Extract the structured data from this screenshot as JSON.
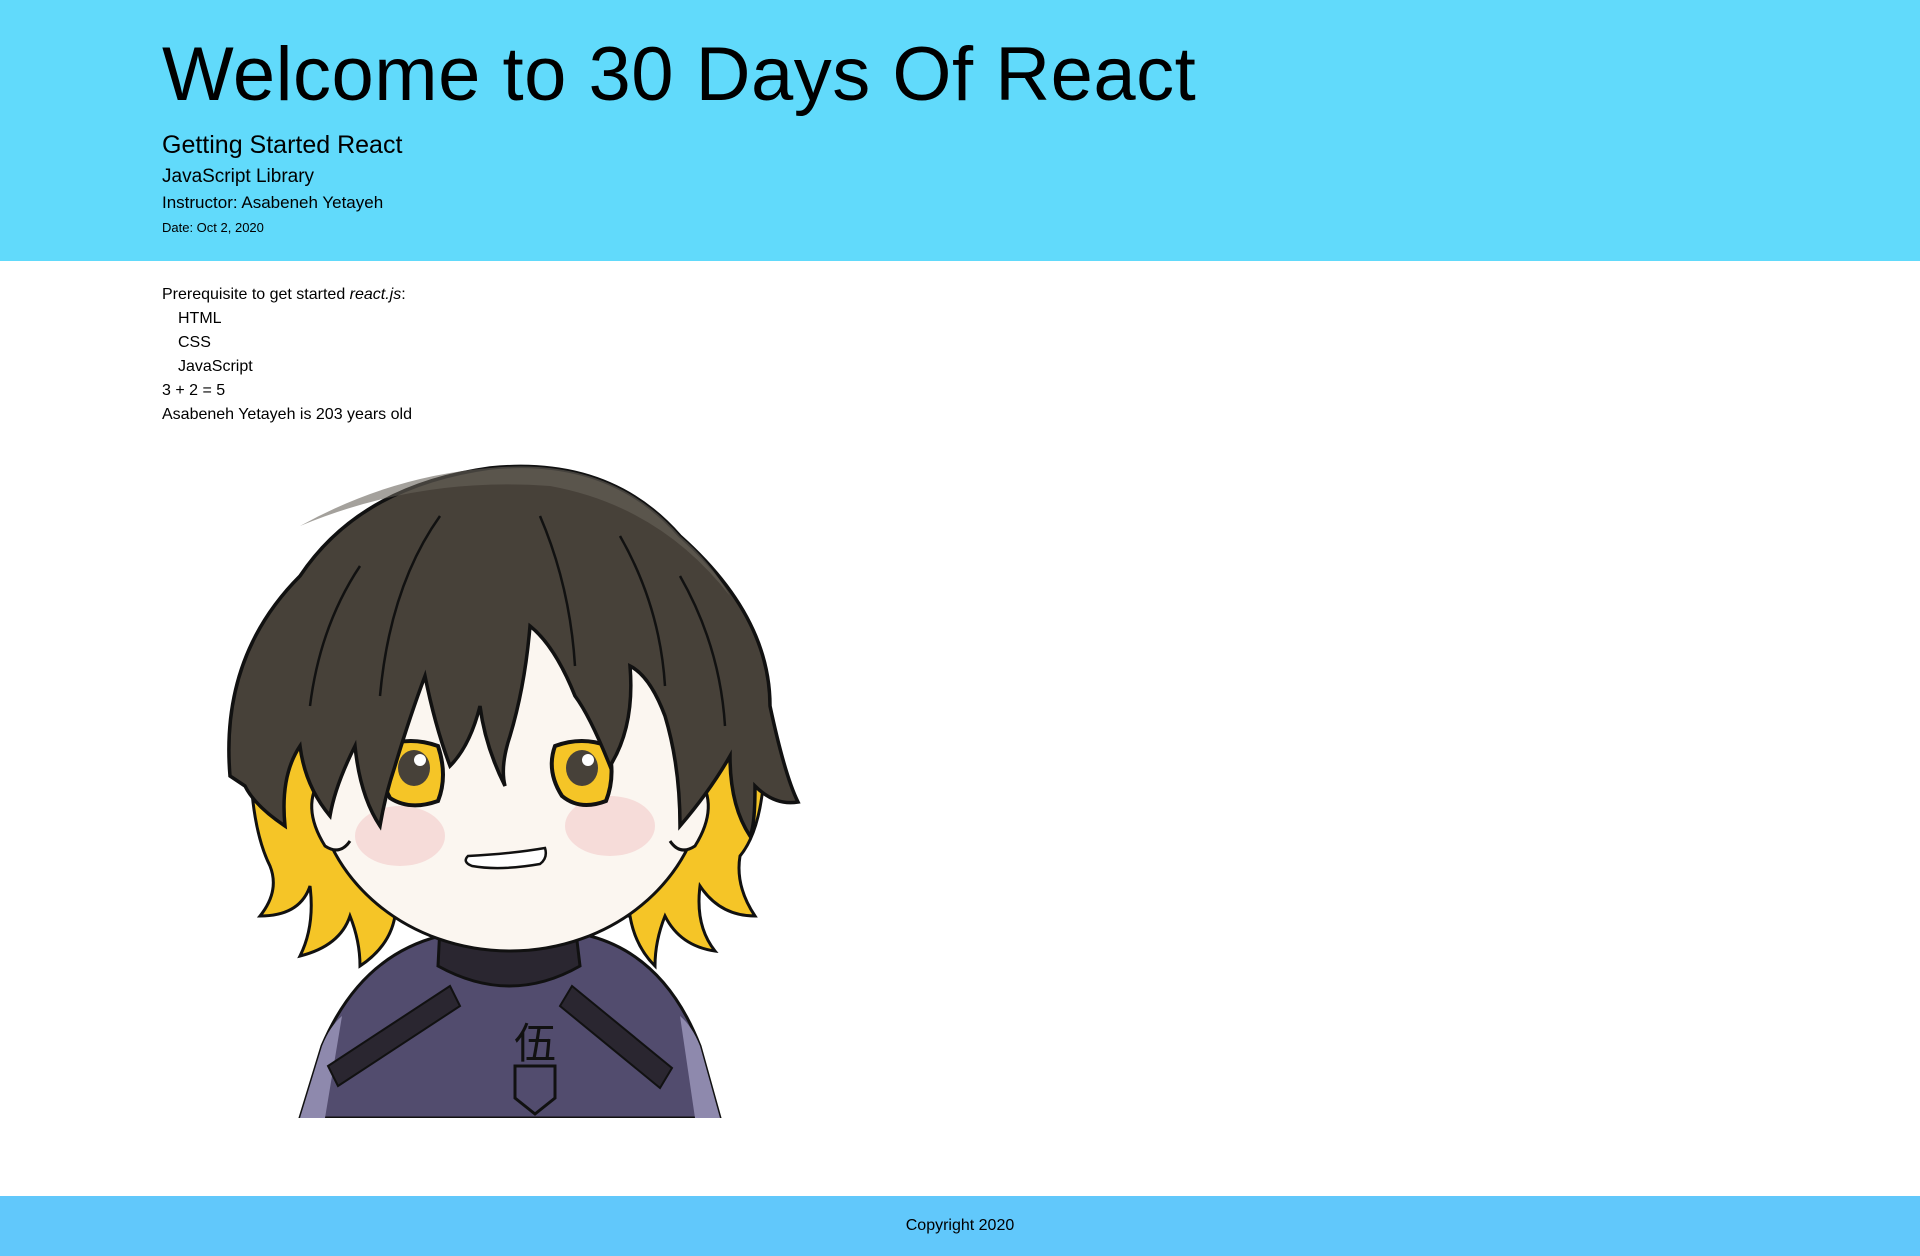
{
  "header": {
    "title": "Welcome to 30 Days Of React",
    "subtitle": "Getting Started React",
    "library": "JavaScript Library",
    "instructor": "Instructor: Asabeneh Yetayeh",
    "date": "Date: Oct 2, 2020"
  },
  "main": {
    "prerequisite_prefix": "Prerequisite to get started ",
    "prerequisite_em": "react.js",
    "prerequisite_suffix": ":",
    "techs": [
      "HTML",
      "CSS",
      "JavaScript"
    ],
    "sum": "3 + 2 = 5",
    "age_text": "Asabeneh Yetayeh is 203 years old"
  },
  "portrait": {
    "shirt_glyph": "伍"
  },
  "footer": {
    "copyright": "Copyright 2020"
  },
  "colors": {
    "header_bg": "#61dafb",
    "footer_bg": "#61c8fb",
    "hair": "#474139",
    "hair_tips": "#f5c527",
    "eyes": "#f5c527",
    "jacket": "#524c6e"
  }
}
